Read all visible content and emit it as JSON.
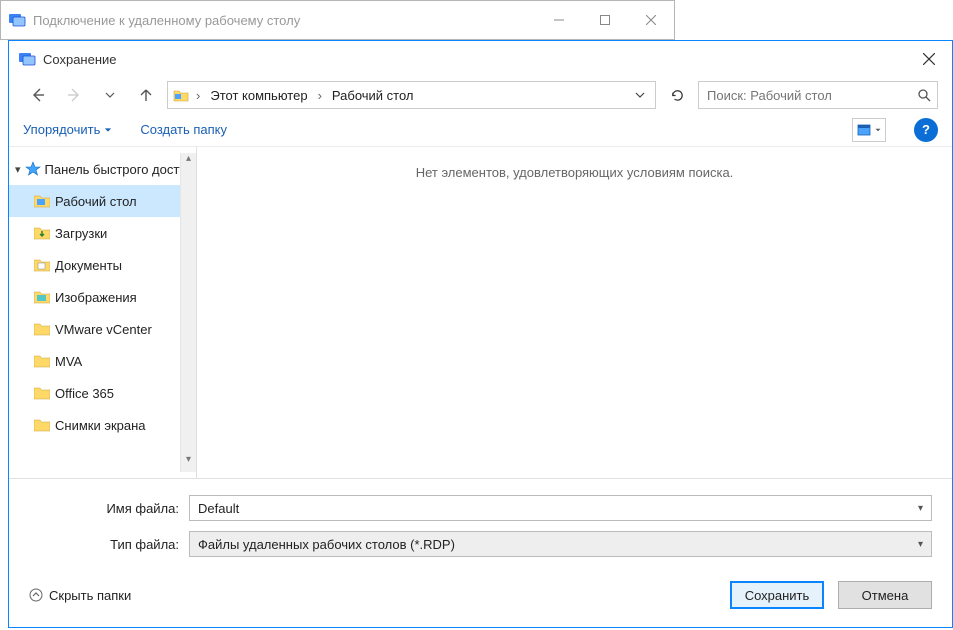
{
  "parent_window": {
    "title": "Подключение к удаленному рабочему столу"
  },
  "dialog": {
    "title": "Сохранение"
  },
  "breadcrumb": {
    "seg1": "Этот компьютер",
    "seg2": "Рабочий стол"
  },
  "search": {
    "placeholder": "Поиск: Рабочий стол"
  },
  "toolbar": {
    "organize": "Упорядочить",
    "new_folder": "Создать папку"
  },
  "tree": {
    "quick_access": "Панель быстрого доступа",
    "items": [
      {
        "label": "Рабочий стол",
        "pinned": true,
        "selected": true,
        "icon": "desktop"
      },
      {
        "label": "Загрузки",
        "pinned": true,
        "icon": "downloads"
      },
      {
        "label": "Документы",
        "pinned": true,
        "icon": "documents"
      },
      {
        "label": "Изображения",
        "pinned": true,
        "icon": "pictures"
      },
      {
        "label": "VMware vCenter",
        "pinned": true,
        "icon": "folder"
      },
      {
        "label": "MVA",
        "pinned": false,
        "icon": "folder"
      },
      {
        "label": "Office 365",
        "pinned": false,
        "icon": "folder"
      },
      {
        "label": "Снимки экрана",
        "pinned": false,
        "icon": "folder"
      }
    ]
  },
  "content": {
    "empty_text": "Нет элементов, удовлетворяющих условиям поиска."
  },
  "fields": {
    "filename_label": "Имя файла:",
    "filename_value": "Default",
    "filetype_label": "Тип файла:",
    "filetype_value": "Файлы удаленных рабочих столов (*.RDP)"
  },
  "footer": {
    "hide_folders": "Скрыть папки",
    "save": "Сохранить",
    "cancel": "Отмена"
  }
}
